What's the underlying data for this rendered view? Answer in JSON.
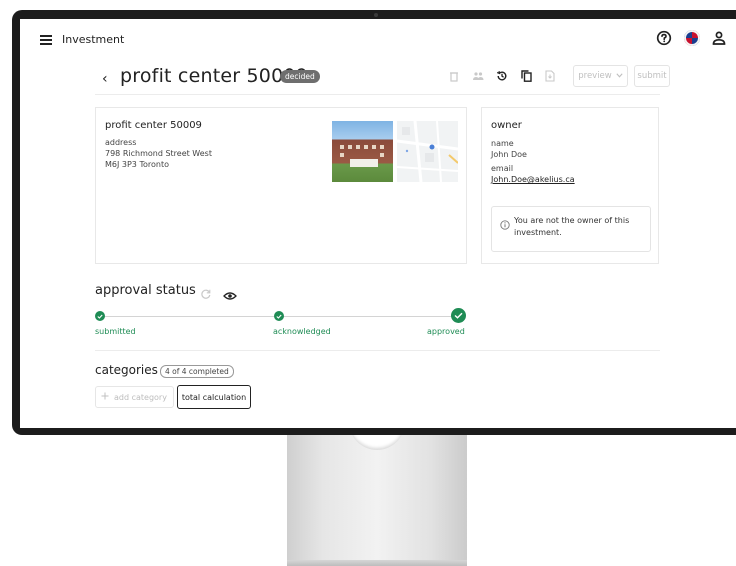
{
  "app": {
    "title": "Investment"
  },
  "header": {
    "title": "profit center 50009",
    "badge": "decided"
  },
  "toolbar": {
    "preview_label": "preview",
    "submit_label": "submit"
  },
  "property": {
    "name": "profit center 50009",
    "address_label": "address",
    "address_line1": "798 Richmond Street West",
    "address_line2": "M6J 3P3 Toronto"
  },
  "owner": {
    "title": "owner",
    "name_label": "name",
    "name": "John Doe",
    "email_label": "email",
    "email": "John.Doe@akelius.ca",
    "notice": "You are not the owner of this investment."
  },
  "approval": {
    "title": "approval status",
    "steps": [
      {
        "label": "submitted",
        "done": true
      },
      {
        "label": "acknowledged",
        "done": true
      },
      {
        "label": "approved",
        "done": true
      }
    ]
  },
  "categories": {
    "title": "categories",
    "count": "4 of 4 completed",
    "add_label": "add category",
    "items": [
      "total calculation"
    ]
  },
  "colors": {
    "success": "#1f8c55",
    "badge": "#6e6e6e",
    "flag_red": "#c8102e",
    "flag_blue": "#1a3d8f"
  }
}
